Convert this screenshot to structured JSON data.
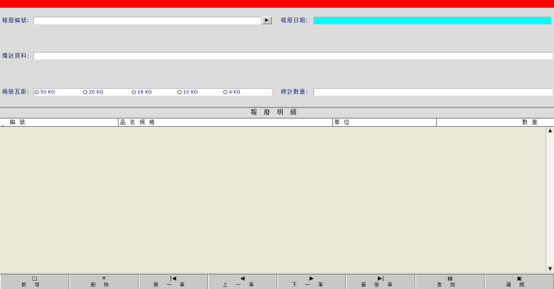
{
  "form": {
    "scrap_no_label": "報廢編號:",
    "scrap_no_value": "",
    "scrap_date_label": "報廢日期:",
    "scrap_date_value": "",
    "remark_label": "備註資料:",
    "remark_value": "",
    "drum_gas_label": "桶裝瓦斯:",
    "drum_options": [
      "50 KG",
      "20 KG",
      "16 KG",
      "10 KG",
      "4 KG"
    ],
    "total_qty_label": "總計數量:",
    "total_qty_value": "",
    "lookup_icon": "lookup-icon"
  },
  "grid": {
    "title": "報廢明細",
    "columns": [
      "編號",
      "品名規格",
      "單位",
      "數量"
    ],
    "rows": []
  },
  "toolbar": {
    "buttons": [
      {
        "label": "新增",
        "icon": "new-document-icon"
      },
      {
        "label": "刪除",
        "icon": "delete-x-icon"
      },
      {
        "label": "第一筆",
        "icon": "first-record-icon"
      },
      {
        "label": "上一筆",
        "icon": "previous-record-icon"
      },
      {
        "label": "下一筆",
        "icon": "next-record-icon"
      },
      {
        "label": "最後筆",
        "icon": "last-record-icon"
      },
      {
        "label": "查詢",
        "icon": "search-document-icon"
      },
      {
        "label": "離開",
        "icon": "save-disk-icon"
      }
    ]
  },
  "colors": {
    "top_bar": "#ff0000",
    "date_field": "#00ffff",
    "background": "#dcdcdc",
    "grid_body": "#ece9d8",
    "label_text": "#1a2a7a"
  }
}
